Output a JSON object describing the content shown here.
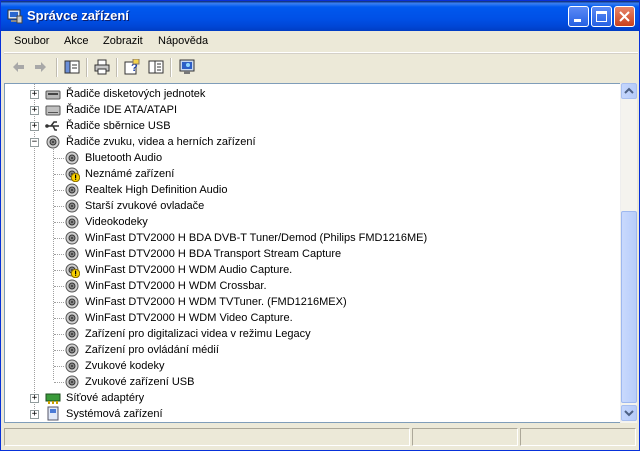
{
  "window": {
    "title": "Správce zařízení"
  },
  "menu": [
    "Soubor",
    "Akce",
    "Zobrazit",
    "Nápověda"
  ],
  "tree": {
    "collapsed_top": [
      {
        "label": "Řadiče disketových jednotek",
        "icon": "floppy-controller-icon"
      },
      {
        "label": "Řadiče IDE ATA/ATAPI",
        "icon": "ide-controller-icon"
      },
      {
        "label": "Řadiče sběrnice USB",
        "icon": "usb-icon"
      }
    ],
    "expanded": {
      "label": "Řadiče zvuku, videa a herních zařízení",
      "icon": "sound-device-icon"
    },
    "children": [
      {
        "label": "Bluetooth Audio",
        "warn": false
      },
      {
        "label": "Neznámé zařízení",
        "warn": true
      },
      {
        "label": "Realtek High Definition Audio",
        "warn": false
      },
      {
        "label": "Starší zvukové ovladače",
        "warn": false
      },
      {
        "label": "Videokodeky",
        "warn": false
      },
      {
        "label": "WinFast DTV2000 H BDA DVB-T Tuner/Demod (Philips FMD1216ME)",
        "warn": false
      },
      {
        "label": "WinFast DTV2000 H BDA Transport Stream Capture",
        "warn": false
      },
      {
        "label": "WinFast DTV2000 H WDM Audio Capture.",
        "warn": true
      },
      {
        "label": "WinFast DTV2000 H WDM Crossbar.",
        "warn": false
      },
      {
        "label": "WinFast DTV2000 H WDM TVTuner. (FMD1216MEX)",
        "warn": false
      },
      {
        "label": "WinFast DTV2000 H WDM Video Capture.",
        "warn": false
      },
      {
        "label": "Zařízení pro digitalizaci videa v režimu Legacy",
        "warn": false
      },
      {
        "label": "Zařízení pro ovládání médií",
        "warn": false
      },
      {
        "label": "Zvukové kodeky",
        "warn": false
      },
      {
        "label": "Zvukové zařízení USB",
        "warn": false
      }
    ],
    "collapsed_bottom": [
      {
        "label": "Síťové adaptéry",
        "icon": "network-adapter-icon"
      },
      {
        "label": "Systémová zařízení",
        "icon": "system-device-icon"
      }
    ]
  },
  "colors": {
    "titlebar": "#0058ee",
    "accent_warning": "#f7d000"
  }
}
